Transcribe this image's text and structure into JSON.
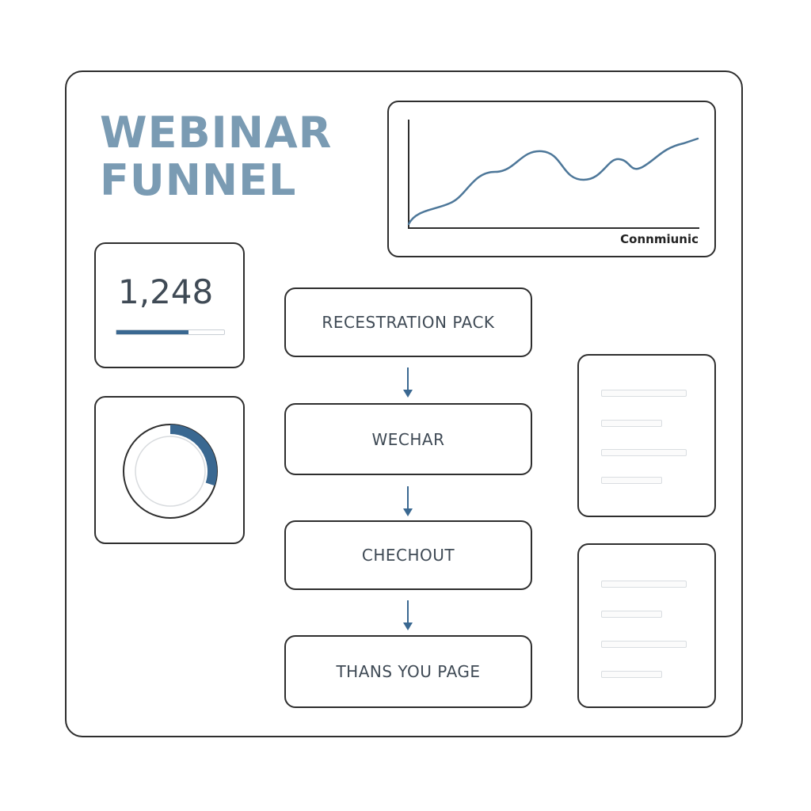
{
  "title": {
    "line1": "WEBINAR",
    "line2": "FUNNEL"
  },
  "trend_chart": {
    "caption": "Connmiunic"
  },
  "registrations_stat": {
    "value": "1,248",
    "progress_fraction": 0.67
  },
  "donut": {
    "fraction": 0.3
  },
  "funnel_steps": [
    {
      "label": "RECESTRATION PACK"
    },
    {
      "label": "WECHAR"
    },
    {
      "label": "CHECHOUT"
    },
    {
      "label": "THANS YOU PAGE"
    }
  ],
  "colors": {
    "title": "#7a9bb3",
    "accent": "#3a6891",
    "line": "#4d7799",
    "border": "#2e2e2e",
    "text": "#3f4a55"
  },
  "icons": {
    "flow_arrow": "arrow-down-icon"
  }
}
